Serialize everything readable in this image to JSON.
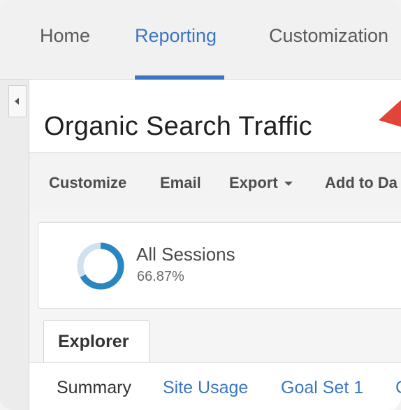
{
  "nav": {
    "tabs": [
      {
        "label": "Home"
      },
      {
        "label": "Reporting",
        "active": true
      },
      {
        "label": "Customization"
      }
    ],
    "accent_color": "#3b76c4"
  },
  "report": {
    "title": "Organic Search Traffic"
  },
  "toolbar": {
    "customize": "Customize",
    "email": "Email",
    "export": "Export",
    "add_to_dashboard": "Add to Da"
  },
  "segment": {
    "name": "All Sessions",
    "value": "66.87%",
    "fraction": 0.6687
  },
  "explorer": {
    "tab_label": "Explorer",
    "subtabs": [
      "Summary",
      "Site Usage",
      "Goal Set 1",
      "C"
    ]
  },
  "icons": {
    "collapse": "chevron-left-icon",
    "export_caret": "caret-down-icon",
    "annotation": "red-arrow-icon"
  }
}
